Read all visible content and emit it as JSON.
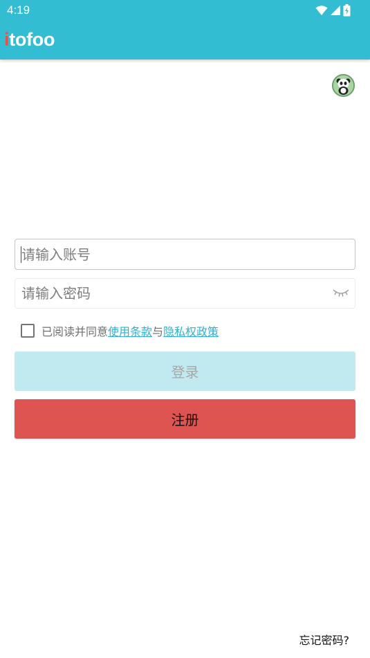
{
  "status_bar": {
    "time": "4:19",
    "icons": [
      "wifi-icon",
      "signal-icon",
      "battery-charging-icon"
    ]
  },
  "app_bar": {
    "logo_first": "i",
    "logo_rest": "tofoo",
    "background": "#33bdd2",
    "logo_accent": "#e3544d"
  },
  "avatar": {
    "icon": "panda-avatar-icon"
  },
  "login_form": {
    "account_placeholder": "请输入账号",
    "account_value": "",
    "password_placeholder": "请输入密码",
    "password_value": "",
    "password_toggle_icon": "eye-closed-icon"
  },
  "agreement": {
    "checked": false,
    "prefix": "已阅读并同意",
    "terms_link": "使用条款",
    "conjunction": "与",
    "privacy_link": "隐私权政策",
    "link_color": "#2fb0cf"
  },
  "buttons": {
    "login_label": "登录",
    "register_label": "注册",
    "login_color": "#c1eaf0",
    "register_color": "#dd5451"
  },
  "forgot_password": "忘记密码?"
}
